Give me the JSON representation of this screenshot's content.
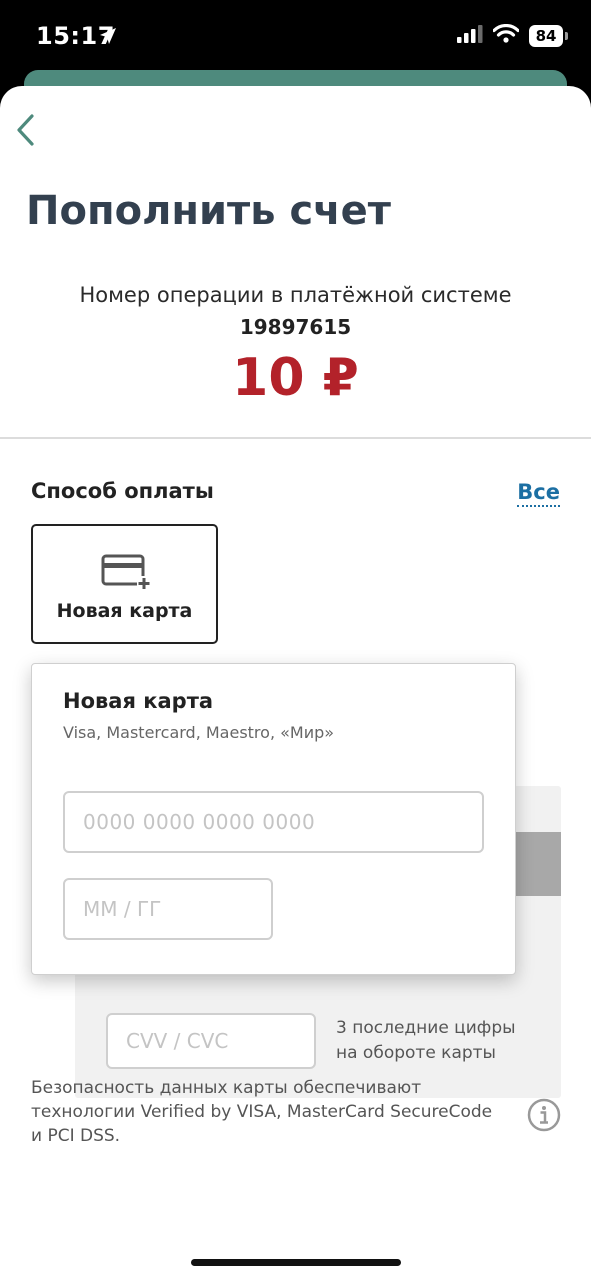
{
  "status_bar": {
    "time": "15:17",
    "battery": "84"
  },
  "header": {
    "title": "Пополнить счет"
  },
  "operation": {
    "label": "Номер операции в платёжной системе",
    "number": "19897615",
    "amount": "10 ₽"
  },
  "payment_method": {
    "label": "Способ оплаты",
    "all_link": "Все",
    "tile_label": "Новая карта"
  },
  "card_form": {
    "title": "Новая карта",
    "subtitle": "Visa, Mastercard, Maestro, «Мир»",
    "card_number_placeholder": "0000 0000 0000 0000",
    "expiry_placeholder": "ММ / ГГ",
    "cvv_placeholder": "CVV / CVC",
    "cvv_hint": "3 последние цифры на обороте карты"
  },
  "footer": {
    "security_text": "Безопасность данных карты обеспечивают технологии Verified by VISA, MasterCard SecureCode и PCI DSS."
  },
  "colors": {
    "accent_teal": "#4e8a7d",
    "amount_red": "#b3222a",
    "link_blue": "#1c6fa3",
    "title_dark": "#33404f"
  }
}
